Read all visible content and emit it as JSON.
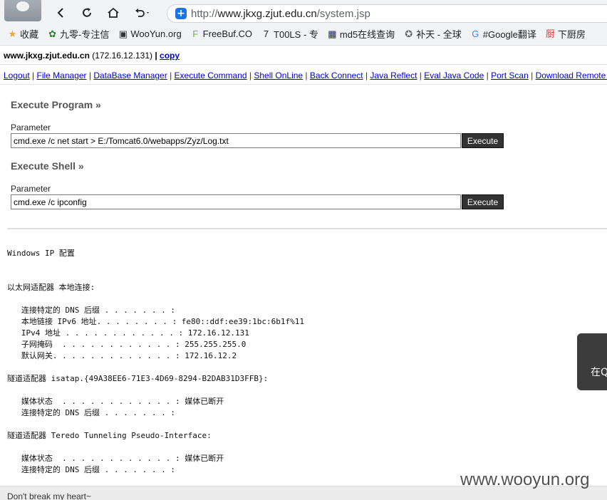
{
  "browser": {
    "url_prefix": "http://",
    "url_host": "www.jkxg.zjut.edu.cn",
    "url_path": "/system.jsp",
    "bookmarks": [
      {
        "label": "收藏",
        "icon": "star-icon",
        "color": "#f5a623"
      },
      {
        "label": "九零-专注信",
        "icon": "leaf-icon",
        "color": "#2e7d32"
      },
      {
        "label": "WooYun.org",
        "icon": "wooyun-icon",
        "color": "#333333"
      },
      {
        "label": "FreeBuf.CO",
        "icon": "freebuf-icon",
        "color": "#7cb342"
      },
      {
        "label": "T00LS - 专",
        "icon": "tools-icon",
        "color": "#222222"
      },
      {
        "label": "md5在线查询",
        "icon": "grid-icon",
        "color": "#1a237e"
      },
      {
        "label": "补天 - 全球",
        "icon": "butian-icon",
        "color": "#666666"
      },
      {
        "label": "#Google翻译",
        "icon": "translate-icon",
        "color": "#4285f4"
      },
      {
        "label": "下厨房",
        "icon": "kitchen-icon",
        "color": "#e53935"
      }
    ]
  },
  "header": {
    "host": "www.jkxg.zjut.edu.cn",
    "ip": "(172.16.12.131)",
    "separator": "|",
    "copy_label": "copy"
  },
  "menu": [
    "Logout",
    "File Manager",
    "DataBase Manager",
    "Execute Command",
    "Shell OnLine",
    "Back Connect",
    "Java Reflect",
    "Eval Java Code",
    "Port Scan",
    "Download Remote File"
  ],
  "program": {
    "title": "Execute Program »",
    "label": "Parameter",
    "value": "cmd.exe /c net start > E:/Tomcat6.0/webapps/Zyz/Log.txt",
    "button": "Execute"
  },
  "shell": {
    "title": "Execute Shell »",
    "label": "Parameter",
    "value": "cmd.exe /c ipconfig",
    "button": "Execute"
  },
  "output": "Windows IP 配置\n\n\n以太网适配器 本地连接:\n\n   连接特定的 DNS 后缀 . . . . . . . :\n   本地链接 IPv6 地址. . . . . . . . : fe80::ddf:ee39:1bc:6b1f%11\n   IPv4 地址 . . . . . . . . . . . . : 172.16.12.131\n   子网掩码  . . . . . . . . . . . . : 255.255.255.0\n   默认网关. . . . . . . . . . . . . : 172.16.12.2\n\n隧道适配器 isatap.{49A38EE6-71E3-4D69-8294-B2DAB31D3FFB}:\n\n   媒体状态  . . . . . . . . . . . . : 媒体已断开\n   连接特定的 DNS 后缀 . . . . . . . :\n\n隧道适配器 Teredo Tunneling Pseudo-Interface:\n\n   媒体状态  . . . . . . . . . . . . : 媒体已断开\n   连接特定的 DNS 后缀 . . . . . . . :",
  "footer": "Don't break my heart~",
  "side_tab": "在Q",
  "watermark": "www.wooyun.org"
}
